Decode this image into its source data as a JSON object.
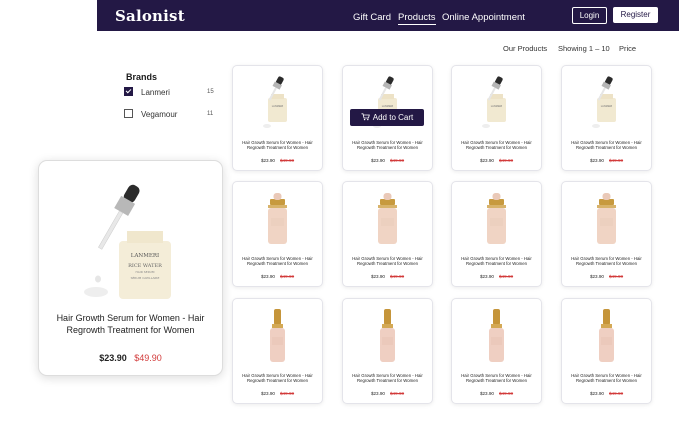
{
  "header": {
    "logo": "Salonist",
    "nav": [
      "Gift Card",
      "Products",
      "Online Appointment"
    ],
    "active_nav": "Products",
    "login_label": "Login",
    "register_label": "Register"
  },
  "toolbar": {
    "breadcrumb": "Our Products",
    "showing": "Showing 1 – 10",
    "sort_label": "Price"
  },
  "filters": {
    "title": "Brands",
    "brands": [
      {
        "name": "Lanmeri",
        "count": "15",
        "checked": true
      },
      {
        "name": "Vegamour",
        "count": "11",
        "checked": false
      }
    ]
  },
  "products": [
    {
      "title": "Hair Growth Serum for Women - Hair Regrowth Treatment for Women",
      "price": "$23.90",
      "old_price": "$49.90",
      "variant": "lanmeri"
    },
    {
      "title": "Hair Growth Serum for Women - Hair Regrowth Treatment for Women",
      "price": "$23.90",
      "old_price": "$49.90",
      "variant": "lanmeri"
    },
    {
      "title": "Hair Growth Serum for Women - Hair Regrowth Treatment for Women",
      "price": "$23.90",
      "old_price": "$49.90",
      "variant": "lanmeri"
    },
    {
      "title": "Hair Growth Serum for Women - Hair Regrowth Treatment for Women",
      "price": "$23.90",
      "old_price": "$49.90",
      "variant": "lanmeri"
    },
    {
      "title": "Hair Growth Serum for Women - Hair Regrowth Treatment for Women",
      "price": "$23.90",
      "old_price": "$49.90",
      "variant": "pink"
    },
    {
      "title": "Hair Growth Serum for Women - Hair Regrowth Treatment for Women",
      "price": "$23.90",
      "old_price": "$49.90",
      "variant": "pink"
    },
    {
      "title": "Hair Growth Serum for Women - Hair Regrowth Treatment for Women",
      "price": "$23.90",
      "old_price": "$49.90",
      "variant": "pink"
    },
    {
      "title": "Hair Growth Serum for Women - Hair Regrowth Treatment for Women",
      "price": "$23.90",
      "old_price": "$49.90",
      "variant": "pink"
    },
    {
      "title": "Hair Growth Serum for Women - Hair Regrowth Treatment for Women",
      "price": "$23.90",
      "old_price": "$49.90",
      "variant": "tall"
    },
    {
      "title": "Hair Growth Serum for Women - Hair Regrowth Treatment for Women",
      "price": "$23.90",
      "old_price": "$49.90",
      "variant": "tall"
    },
    {
      "title": "Hair Growth Serum for Women - Hair Regrowth Treatment for Women",
      "price": "$23.90",
      "old_price": "$49.90",
      "variant": "tall"
    },
    {
      "title": "Hair Growth Serum for Women - Hair Regrowth Treatment for Women",
      "price": "$23.90",
      "old_price": "$49.90",
      "variant": "tall"
    }
  ],
  "hover_card": {
    "add_to_cart_label": "Add to Cart"
  },
  "featured": {
    "title": "Hair Growth Serum for Women - Hair Regrowth Treatment for Women",
    "price": "$23.90",
    "old_price": "$49.90",
    "bottle_text": [
      "LANMERI",
      "RICE WATER",
      "HAIR SERUM",
      "SÉRUM CAPILLAIRE"
    ]
  },
  "colors": {
    "brand": "#231845",
    "sale": "#d23a3a"
  }
}
